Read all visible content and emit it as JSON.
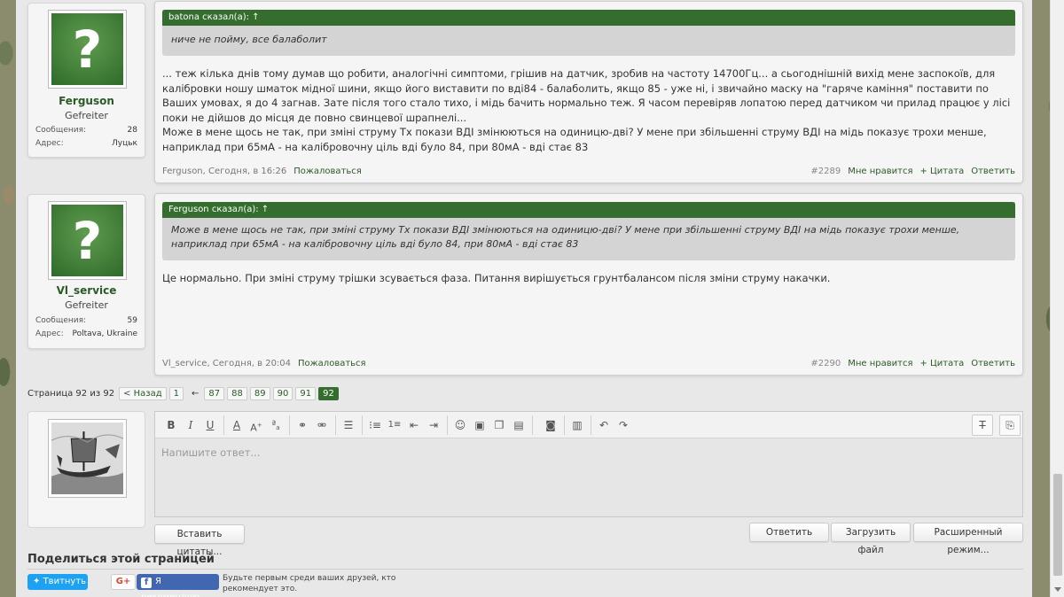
{
  "posts": [
    {
      "user": {
        "name": "Ferguson",
        "title": "Gefreiter",
        "messages_label": "Сообщения:",
        "messages": "28",
        "address_label": "Адрес:",
        "address": "Луцьк"
      },
      "quote": {
        "header": "batona сказал(а): ↑",
        "text": "ниче не пойму, все балаболит"
      },
      "body": [
        "... теж кілька днів тому думав що робити, аналогічні симптоми, грішив на датчик, зробив на частоту 14700Гц... а сьогоднішній вихід мене заспокоїв, для",
        "калібровки ношу шматок мідної шини, якщо його виставити по вді84 - балаболить, якщо 85 - уже ні, і звичайно маску на \"гаряче каміння\" поставити по",
        "Ваших умовах, я до 4 загнав. Зате після того стало тихо, і мідь бачить нормально теж. Я часом перевіряв лопатою перед датчиком чи прилад працює у лісі",
        "поки не дійшов до місця де повно свинцевої шрапнелі...",
        "Може в мене щось не так, при зміні струму Тх покази ВДІ змінюються на одиницю-дві? У мене при збільшенні струму ВДІ на мідь показує трохи менше,",
        "наприклад при 65мА - на калібровочну ціль вді було 84, при 80мА - вді стає 83"
      ],
      "meta": {
        "author_date": "Ferguson, Сегодня, в 16:26",
        "report": "Пожаловаться",
        "number": "#2289",
        "like": "Мне нравится",
        "quote": "+ Цитата",
        "reply": "Ответить"
      }
    },
    {
      "user": {
        "name": "Vl_service",
        "title": "Gefreiter",
        "messages_label": "Сообщения:",
        "messages": "59",
        "address_label": "Адрес:",
        "address": "Poltava, Ukraine"
      },
      "quote": {
        "header": "Ferguson сказал(а): ↑",
        "text": "Може в мене щось не так, при зміні струму Тх покази ВДІ змінюються на одиницю-дві? У мене при збільшенні струму ВДІ на мідь показує трохи менше, наприклад при 65мА - на калібровочну ціль вді було 84, при 80мА - вді стає 83"
      },
      "body": [
        "Це нормально. При зміні струму трішки зсувається фаза. Питання вирішується грунтбалансом після зміни струму накачки."
      ],
      "meta": {
        "author_date": "Vl_service, Сегодня, в 20:04",
        "report": "Пожаловаться",
        "number": "#2290",
        "like": "Мне нравится",
        "quote": "+ Цитата",
        "reply": "Ответить"
      }
    }
  ],
  "pagination": {
    "label": "Страница 92 из 92",
    "prev": "< Назад",
    "first": "1",
    "ellipsis": "←",
    "pages": [
      "87",
      "88",
      "89",
      "90",
      "91",
      "92"
    ],
    "current": "92"
  },
  "editor": {
    "placeholder": "Напишите ответ...",
    "toolbar_icons": [
      "bold",
      "italic",
      "underline",
      "font-color",
      "font-size",
      "font-family",
      "link",
      "unlink",
      "align",
      "bullet-list",
      "numbered-list",
      "outdent",
      "indent",
      "smilies",
      "image",
      "media",
      "code",
      "camera",
      "save",
      "undo",
      "redo"
    ]
  },
  "buttons": {
    "insert_quotes": "Вставить цитаты...",
    "reply": "Ответить",
    "upload": "Загрузить файл",
    "advanced": "Расширенный режим..."
  },
  "share": {
    "title": "Поделиться этой страницей",
    "tweet": "Твитнуть",
    "gplus": "G+",
    "fb_recommend": "Я рекомендую",
    "fb_text": "Будьте первым среди ваших друзей, кто рекомендует это."
  }
}
